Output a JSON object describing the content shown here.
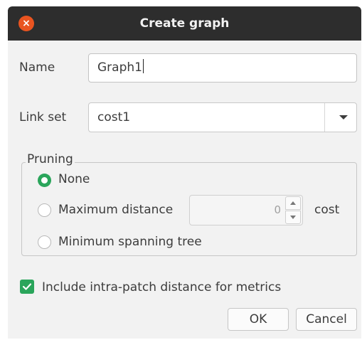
{
  "window": {
    "title": "Create graph",
    "close_icon": "close-icon",
    "close_symbol": "×"
  },
  "name": {
    "label": "Name",
    "value": "Graph1"
  },
  "link_set": {
    "label": "Link set",
    "value": "cost1"
  },
  "pruning": {
    "title": "Pruning",
    "options": [
      {
        "label": "None",
        "checked": true
      },
      {
        "label": "Maximum distance",
        "checked": false
      },
      {
        "label": "Minimum spanning tree",
        "checked": false
      }
    ],
    "max_distance_value": "0",
    "unit": "cost"
  },
  "intra_patch": {
    "label": "Include intra-patch distance for metrics",
    "checked": true
  },
  "buttons": {
    "ok": "OK",
    "cancel": "Cancel"
  },
  "colors": {
    "accent": "#2aa55b",
    "close": "#e95420",
    "titlebar": "#2d2d2d"
  }
}
